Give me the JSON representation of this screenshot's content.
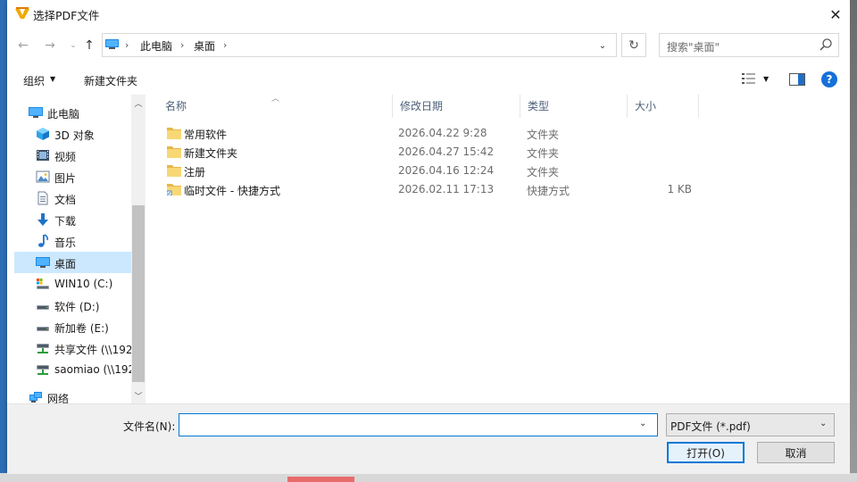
{
  "window": {
    "title": "选择PDF文件",
    "close_glyph": "✕"
  },
  "nav": {
    "back_glyph": "←",
    "forward_glyph": "→",
    "recent_glyph": "⌄",
    "up_glyph": "↑",
    "breadcrumbs": [
      "此电脑",
      "桌面"
    ],
    "sep_glyph": "›",
    "dropdown_glyph": "⌄",
    "refresh_glyph": "↻",
    "search_placeholder": "搜索\"桌面\""
  },
  "toolbar": {
    "organize_label": "组织",
    "newfolder_label": "新建文件夹",
    "arrow_glyph": "▼",
    "help_glyph": "?"
  },
  "sidebar": {
    "scroll_up_glyph": "︿",
    "scroll_down_glyph": "﹀",
    "items": [
      {
        "label": "此电脑",
        "icon": "computer-icon"
      },
      {
        "label": "3D 对象",
        "icon": "cube-icon"
      },
      {
        "label": "视频",
        "icon": "video-icon"
      },
      {
        "label": "图片",
        "icon": "picture-icon"
      },
      {
        "label": "文档",
        "icon": "document-icon"
      },
      {
        "label": "下载",
        "icon": "download-icon"
      },
      {
        "label": "音乐",
        "icon": "music-icon"
      },
      {
        "label": "桌面",
        "icon": "desktop-icon",
        "selected": true
      },
      {
        "label": "WIN10 (C:)",
        "icon": "system-drive-icon"
      },
      {
        "label": "软件 (D:)",
        "icon": "drive-icon"
      },
      {
        "label": "新加卷 (E:)",
        "icon": "drive-icon"
      },
      {
        "label": "共享文件 (\\\\192",
        "icon": "network-drive-icon"
      },
      {
        "label": "saomiao (\\\\192",
        "icon": "network-drive-icon"
      },
      {
        "label": "网络",
        "icon": "network-icon"
      }
    ]
  },
  "filelist": {
    "sort_glyph": "︿",
    "columns": {
      "name": "名称",
      "date": "修改日期",
      "type": "类型",
      "size": "大小"
    },
    "rows": [
      {
        "name": "常用软件",
        "date": "2026.04.22 9:28",
        "type": "文件夹",
        "size": ""
      },
      {
        "name": "新建文件夹",
        "date": "2026.04.27 15:42",
        "type": "文件夹",
        "size": ""
      },
      {
        "name": "注册",
        "date": "2026.04.16 12:24",
        "type": "文件夹",
        "size": ""
      },
      {
        "name": "临时文件 - 快捷方式",
        "date": "2026.02.11 17:13",
        "type": "快捷方式",
        "size": "1 KB"
      }
    ]
  },
  "footer": {
    "filename_label": "文件名(N):",
    "filename_value": "",
    "filetype_value": "PDF文件 (*.pdf)",
    "dropdown_glyph": "⌄",
    "open_label": "打开(O)",
    "cancel_label": "取消"
  },
  "colors": {
    "accent": "#0078d7",
    "selected_bg": "#cce8ff",
    "folder": "#f8d775",
    "help": "#1570d9"
  }
}
